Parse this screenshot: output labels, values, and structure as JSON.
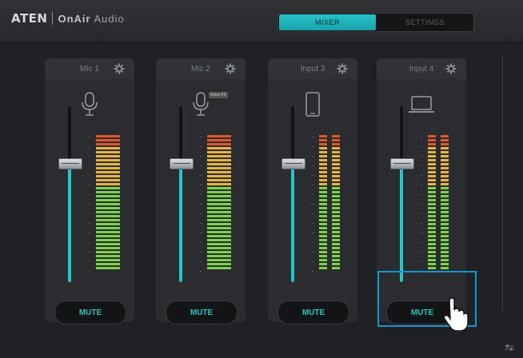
{
  "app": {
    "brand": {
      "logo": "ATEN",
      "product": "OnAir",
      "product_sub": "Audio"
    },
    "tabs": [
      {
        "label": "MIXER",
        "active": true
      },
      {
        "label": "SETTINGS",
        "active": false
      }
    ]
  },
  "channels": [
    {
      "name": "Mic 1",
      "icon": "microphone-icon",
      "badge": "",
      "fader_level": 0.66,
      "meter": "mono",
      "mute_label": "MUTE",
      "meter_fill": 1.0
    },
    {
      "name": "Mic 2",
      "icon": "microphone-icon",
      "badge": "Voice FX",
      "fader_level": 0.66,
      "meter": "mono",
      "mute_label": "MUTE",
      "meter_fill": 1.0
    },
    {
      "name": "Input 3",
      "icon": "phone-icon",
      "badge": "",
      "fader_level": 0.66,
      "meter": "stereo",
      "mute_label": "MUTE",
      "meter_fill": 1.0
    },
    {
      "name": "Input 4",
      "icon": "laptop-icon",
      "badge": "",
      "fader_level": 0.66,
      "meter": "stereo",
      "mute_label": "MUTE",
      "meter_fill": 1.0
    }
  ],
  "colors": {
    "accent": "#25c6c9",
    "highlight": "#1596d2",
    "meter_green": "#7bd34a",
    "meter_yellow": "#e8b43a",
    "meter_red": "#e2562a"
  }
}
